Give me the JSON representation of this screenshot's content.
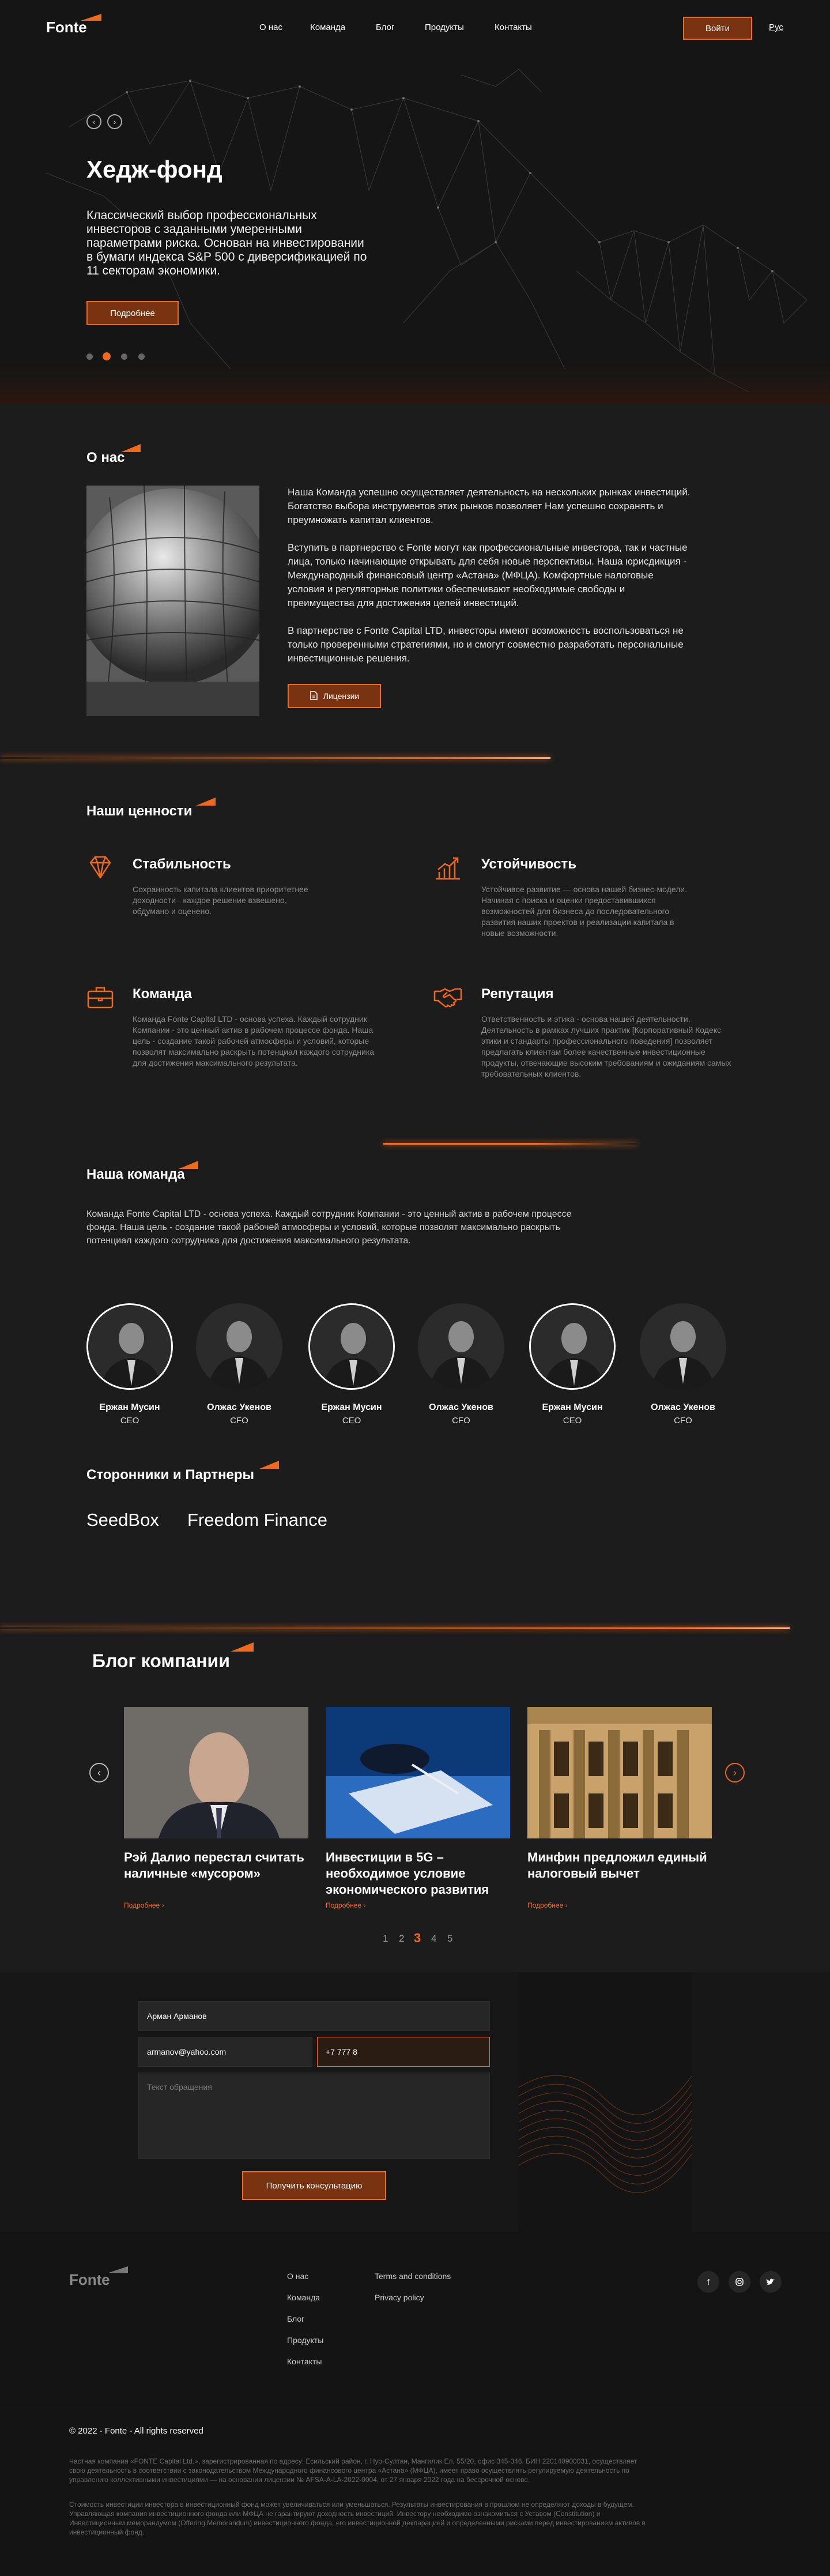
{
  "colors": {
    "accent": "#ef6a1a",
    "background": "#1c1c1c",
    "button_fill": "#7a3310"
  },
  "header": {
    "logo": "Fonte",
    "nav": [
      "О нас",
      "Команда",
      "Блог",
      "Продукты",
      "Контакты"
    ],
    "login": "Войти",
    "lang": "Рус"
  },
  "hero": {
    "title": "Хедж-фонд",
    "text": "Классический выбор профессиональных инвесторов с заданными умеренными параметрами риска. Основан на инвестировании в бумаги индекса S&P 500 с диверсификацией по 11 секторам экономики.",
    "button": "Подробнее",
    "active_slide": 2,
    "slides_count": 4
  },
  "about": {
    "title": "О нас",
    "paragraphs": [
      "Наша Команда успешно осуществляет деятельность на нескольких рынках инвестиций. Богатство выбора инструментов этих рынков позволяет Нам успешно сохранять и преумножать капитал клиентов.",
      "Вступить в партнерство с Fonte могут как профессиональные инвестора, так и частные лица, только начинающие открывать для себя новые перспективы. Наша юрисдикция - Международный финансовый центр «Астана» (МФЦА). Комфортные налоговые условия и регуляторные политики обеспечивают необходимые свободы и преимущества для достижения целей инвестиций.",
      "В партнерстве с Fonte Capital LTD, инвесторы имеют возможность воспользоваться не только проверенными стратегиями, но и смогут совместно разработать персональные инвестиционные решения."
    ],
    "button": "Лицензии"
  },
  "values": {
    "title": "Наши ценности",
    "items": [
      {
        "title": "Стабильность",
        "icon": "diamond-icon",
        "text": "Сохранность капитала клиентов приоритетнее доходности - каждое решение взвешено, обдумано и оценено."
      },
      {
        "title": "Устойчивость",
        "icon": "growth-chart-icon",
        "text": "Устойчивое развитие — основа нашей бизнес-модели. Начиная с поиска и оценки предоставившихся возможностей для бизнеса до последовательного развития наших проектов и реализации капитала в новые возможности."
      },
      {
        "title": "Команда",
        "icon": "briefcase-icon",
        "text": "Команда Fonte Capital LTD - основа успеха. Каждый сотрудник Компании - это ценный актив в рабочем процессе фонда. Наша цель - создание такой рабочей атмосферы и условий, которые позволят максимально раскрыть потенциал каждого сотрудника для достижения максимального результата."
      },
      {
        "title": "Репутация",
        "icon": "handshake-icon",
        "text": "Ответственность и этика - основа нашей деятельности. Деятельность в рамках лучших практик [Корпоративный Кодекс этики и стандарты профессионального поведения] позволяет предлагать клиентам более качественные инвестиционные продукты, отвечающие высоким требованиям и ожиданиям самых требовательных клиентов."
      }
    ]
  },
  "team": {
    "title": "Наша команда",
    "intro": "Команда Fonte Capital LTD - основа успеха. Каждый сотрудник Компании - это ценный актив в рабочем процессе фонда. Наша цель - создание такой рабочей атмосферы и условий, которые позволят максимально раскрыть потенциал каждого сотрудника для достижения максимального результата.",
    "members": [
      {
        "name": "Ержан Мусин",
        "role": "CEO"
      },
      {
        "name": "Олжас Укенов",
        "role": "CFO"
      },
      {
        "name": "Ержан Мусин",
        "role": "CEO"
      },
      {
        "name": "Олжас Укенов",
        "role": "CFO"
      },
      {
        "name": "Ержан Мусин",
        "role": "CEO"
      },
      {
        "name": "Олжас Укенов",
        "role": "CFO"
      }
    ]
  },
  "partners": {
    "title": "Сторонники и Партнеры",
    "items": [
      "SeedBox",
      "Freedom Finance"
    ]
  },
  "blog": {
    "title": "Блог компании",
    "cards": [
      {
        "title": "Рэй Далио перестал считать наличные «мусором»",
        "more": "Подробнее"
      },
      {
        "title": "Инвестиции в 5G – необходимое условие экономического развития",
        "more": "Подробнее"
      },
      {
        "title": "Минфин предложил единый налоговый вычет",
        "more": "Подробнее"
      }
    ],
    "pages": [
      "1",
      "2",
      "3",
      "4",
      "5"
    ],
    "active_page": "3"
  },
  "form": {
    "name_value": "Арман Арманов",
    "email_value": "armanov@yahoo.com",
    "phone_value": "+7 777 8",
    "message_placeholder": "Текст обращения",
    "submit": "Получить консультацию"
  },
  "footer": {
    "logo": "Fonte",
    "col1": [
      "О нас",
      "Команда",
      "Блог",
      "Продукты",
      "Контакты"
    ],
    "col2": [
      "Terms and conditions",
      "Privacy policy"
    ],
    "social": [
      "facebook-icon",
      "instagram-icon",
      "twitter-icon"
    ],
    "copyright": "© 2022 - Fonte - All rights reserved",
    "legal1": "Частная компания «FONTE Capital Ltd.», зарегистрированная по адресу: Есильский район, г. Нур-Султан, Мангилик Ел, 55/20, офис 345-346, БИН 220140900031, осуществляет свою деятельность в соответствии с законодательством Международного финансового центра «Астана» (МФЦА), имеет право осуществлять регулируемую деятельность по управлению коллективными инвестициями — на основании лицензии № AFSA-A-LA-2022-0004, от 27 января 2022 года на бессрочной основе.",
    "legal2": "Стоимость инвестиции инвестора в инвестиционный фонд может увеличиваться или уменьшаться. Результаты инвестирования в прошлом не определяют доходы в будущем. Управляющая компания инвестиционного фонда или МФЦА не гарантируют доходность инвестиций. Инвестору необходимо ознакомиться с Уставом (Constitution) и Инвестиционным меморандумом (Offering Memorandum) инвестиционного фонда, его инвестиционной декларацией и определенными рисками перед инвестированием активов в инвестиционный фонд."
  }
}
